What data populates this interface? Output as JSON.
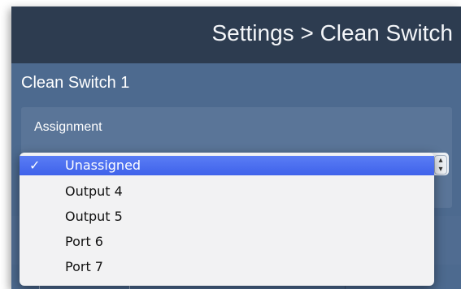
{
  "header": {
    "title": "Settings > Clean Switch"
  },
  "clean_switch": {
    "title": "Clean Switch 1",
    "assignment_label": "Assignment"
  },
  "dropdown": {
    "selected_index": 0,
    "options": [
      {
        "label": "Unassigned",
        "selected": true
      },
      {
        "label": "Output 4",
        "selected": false
      },
      {
        "label": "Output 5",
        "selected": false
      },
      {
        "label": "Port 6",
        "selected": false
      },
      {
        "label": "Port 7",
        "selected": false
      }
    ]
  },
  "icons": {
    "check": "✓",
    "stepper": "updown-arrows-icon"
  },
  "colors": {
    "titlebar": "#2d3c50",
    "panel_background": "#4d6a8f",
    "highlight": "#4a6df0",
    "menu_background": "#f2f2f3"
  }
}
